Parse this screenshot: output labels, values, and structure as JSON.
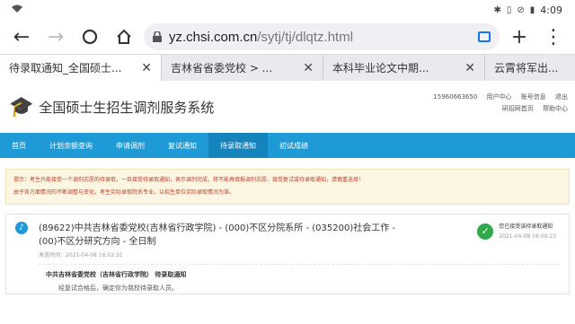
{
  "statusbar": {
    "time": "4:09"
  },
  "browser": {
    "url_host": "yz.chsi.com.cn",
    "url_path": "/sytj/tj/dlqtz.html",
    "tabs": [
      {
        "title": "待录取通知_全国硕士..."
      },
      {
        "title": "吉林省省委党校 > ..."
      },
      {
        "title": "本科毕业论文中期..."
      },
      {
        "title": "云霄将军出..."
      }
    ]
  },
  "site": {
    "title": "全国硕士生招生调剂服务系统",
    "header_links": {
      "phone": "15960663650",
      "user_center": "用户中心",
      "account_info": "账号信息",
      "logout": "退出",
      "home": "研招网首页",
      "help": "帮助中心"
    },
    "nav": [
      "首页",
      "计划余额查询",
      "申请调剂",
      "复试通知",
      "待录取通知",
      "初试成绩"
    ],
    "notice_lines": [
      "提示：考生只能接受一个调剂志愿的待录取，一旦接受待录取通知，表示调剂完成，将不能再填报调剂志愿、接受复试或待录取通知，请慎重选择！",
      "由于各方面情况的不断调整与变化，考生实际录取院系专业，以招生单位实际录取情况为准。"
    ]
  },
  "admission_card": {
    "program": "(89622)中共吉林省委党校(吉林省行政学院) - (000)不区分院系所 - (035200)社会工作 - (00)不区分研究方向 - 全日制",
    "sent_time": "发送时间：2021-04-08 16:02:31",
    "status": "您已接受该待录取通知",
    "status_time": "2021-04-08 16:09:23",
    "notice_title": "中共吉林省委党校（吉林省行政学院） 待录取通知",
    "notice_body": "经复试合格后，确定你为我校待录取人员。"
  }
}
